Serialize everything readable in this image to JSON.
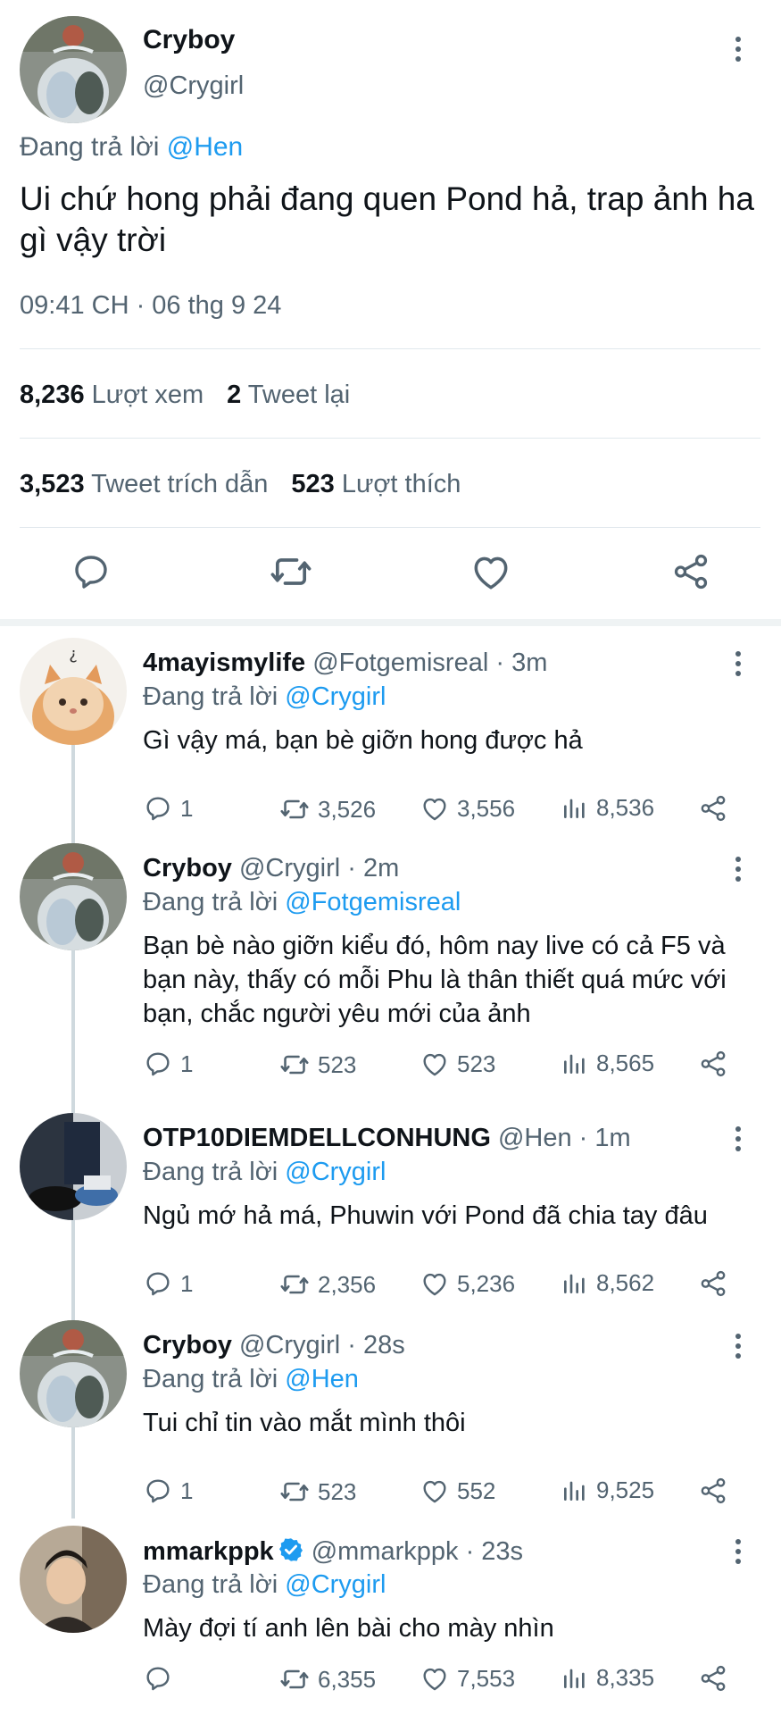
{
  "main_tweet": {
    "name": "Cryboy",
    "handle": "@Crygirl",
    "reply_prefix": "Đang trả lời ",
    "reply_to": "@Hen",
    "text": "Ui chứ hong phải đang quen Pond hả, trap ảnh ha gì vậy trời",
    "timestamp": "09:41 CH · 06 thg 9 24",
    "views_count": "8,236",
    "views_label": "Lượt xem",
    "retweets_count": "2",
    "retweets_label": "Tweet lại",
    "quotes_count": "3,523",
    "quotes_label": "Tweet trích dẫn",
    "likes_count": "523",
    "likes_label": "Lượt thích"
  },
  "replies": [
    {
      "name": "4mayismylife",
      "handle": "@Fotgemisreal",
      "time": " · 3m",
      "reply_prefix": "Đang trả lời ",
      "reply_to": "@Crygirl",
      "text": "Gì vậy má, bạn bè giỡn hong được hả",
      "replies": "1",
      "retweets": "3,526",
      "likes": "3,556",
      "views": "8,536"
    },
    {
      "name": "Cryboy",
      "handle": "@Crygirl",
      "time": " · 2m",
      "reply_prefix": "Đang trả lời ",
      "reply_to": "@Fotgemisreal",
      "text": "Bạn bè nào giỡn kiểu đó, hôm nay live có cả F5 và bạn này, thấy có mỗi Phu là thân thiết quá mức với bạn, chắc người yêu mới của ảnh",
      "replies": "1",
      "retweets": "523",
      "likes": "523",
      "views": "8,565"
    },
    {
      "name": "OTP10DIEMDELLCONHUNG",
      "handle": "@Hen",
      "time": " · 1m",
      "reply_prefix": "Đang trả lời ",
      "reply_to": "@Crygirl",
      "text": "Ngủ mớ hả má, Phuwin với Pond đã chia tay đâu",
      "replies": "1",
      "retweets": "2,356",
      "likes": "5,236",
      "views": "8,562"
    },
    {
      "name": "Cryboy",
      "handle": "@Crygirl",
      "time": " · 28s",
      "reply_prefix": "Đang trả lời ",
      "reply_to": "@Hen",
      "text": "Tui chỉ tin vào mắt mình thôi",
      "replies": "1",
      "retweets": "523",
      "likes": "552",
      "views": "9,525"
    },
    {
      "name": "mmarkppk",
      "handle": "@mmarkppk",
      "time": " · 23s",
      "reply_prefix": "Đang trả lời ",
      "reply_to": "@Crygirl",
      "text": "Mày đợi tí anh lên bài cho mày nhìn",
      "replies": "",
      "retweets": "6,355",
      "likes": "7,553",
      "views": "8,335"
    }
  ],
  "colors": {
    "link": "#1d9bf0",
    "secondary_text": "#536471",
    "primary_text": "#0f1419",
    "verified": "#1d9bf0"
  },
  "icons": [
    "more-vertical-icon",
    "reply-icon",
    "retweet-icon",
    "like-icon",
    "share-icon",
    "views-icon",
    "verified-icon"
  ]
}
